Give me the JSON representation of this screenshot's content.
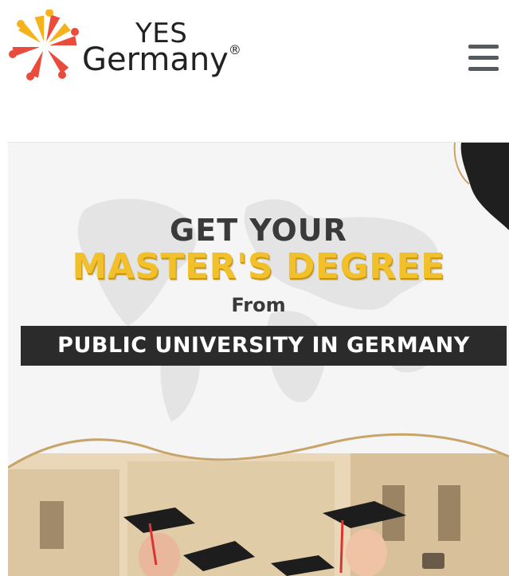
{
  "brand": {
    "line1": "YES",
    "line2": "Germany",
    "registered": "®",
    "icon": "sunburst-logo-icon"
  },
  "nav": {
    "menu_icon": "hamburger-menu-icon"
  },
  "hero": {
    "line1": "GET YOUR",
    "line2": "MASTER'S DEGREE",
    "line3": "From",
    "banner": "PUBLIC UNIVERSITY IN GERMANY",
    "colors": {
      "accent": "#f2c02b",
      "banner_bg": "#2b2b2b",
      "text_dark": "#3a3a3a"
    }
  }
}
